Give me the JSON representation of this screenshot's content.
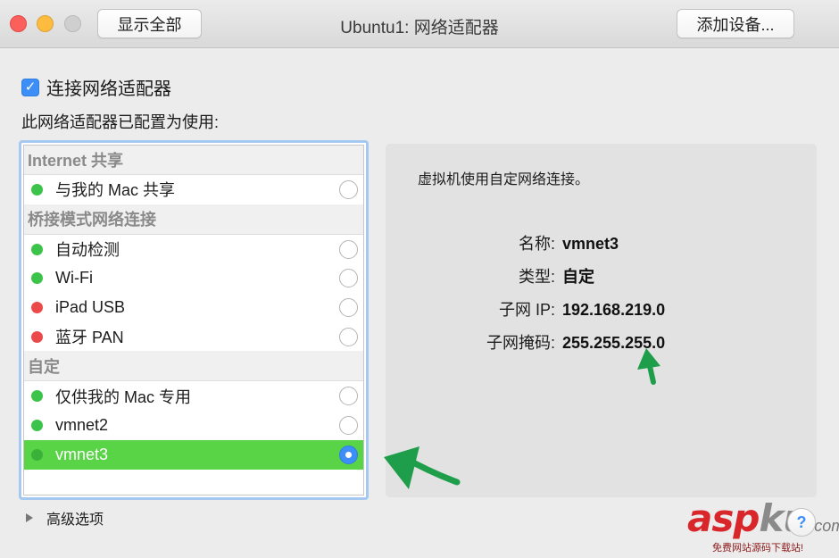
{
  "window": {
    "title": "Ubuntu1: 网络适配器",
    "show_all_label": "显示全部",
    "add_device_label": "添加设备..."
  },
  "connect": {
    "label": "连接网络适配器",
    "checked": true
  },
  "configured_label": "此网络适配器已配置为使用:",
  "list": {
    "sections": [
      {
        "header": "Internet 共享",
        "items": [
          {
            "label": "与我的 Mac 共享",
            "status": "green",
            "selected": false
          }
        ]
      },
      {
        "header": "桥接模式网络连接",
        "items": [
          {
            "label": "自动检测",
            "status": "green",
            "selected": false
          },
          {
            "label": "Wi-Fi",
            "status": "green",
            "selected": false
          },
          {
            "label": "iPad USB",
            "status": "red",
            "selected": false
          },
          {
            "label": "蓝牙 PAN",
            "status": "red",
            "selected": false
          }
        ]
      },
      {
        "header": "自定",
        "items": [
          {
            "label": "仅供我的 Mac 专用",
            "status": "green",
            "selected": false
          },
          {
            "label": "vmnet2",
            "status": "green",
            "selected": false
          },
          {
            "label": "vmnet3",
            "status": "green",
            "selected": true
          }
        ]
      }
    ]
  },
  "details": {
    "description": "虚拟机使用自定网络连接。",
    "fields": [
      {
        "key": "名称:",
        "value": "vmnet3"
      },
      {
        "key": "类型:",
        "value": "自定"
      },
      {
        "key": "子网 IP:",
        "value": "192.168.219.0"
      },
      {
        "key": "子网掩码:",
        "value": "255.255.255.0"
      }
    ]
  },
  "advanced_label": "高级选项",
  "help_label": "?",
  "watermark": {
    "part1": "asp",
    "part2": "ku",
    "part3": ".com",
    "sub": "免费网站源码下载站!"
  },
  "colors": {
    "accent": "#3e8ef7",
    "selected_row": "#59d446",
    "status_green": "#3bc449",
    "status_red": "#ec4a4a",
    "annotation_arrow": "#1e9e4a"
  }
}
